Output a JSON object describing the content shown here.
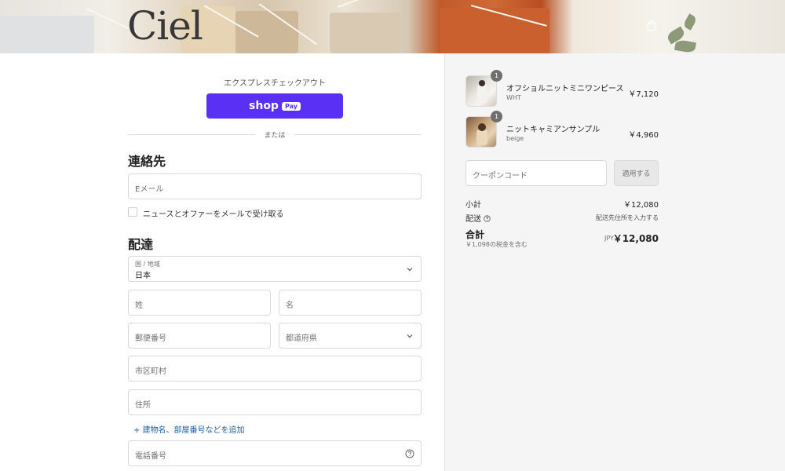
{
  "brand": {
    "logo_text": "Ciel"
  },
  "header": {
    "icon": "shopping-bag-icon"
  },
  "express": {
    "title": "エクスプレスチェックアウト",
    "shop_label": "shop",
    "pay_label": "Pay",
    "accent": "#5a31f4",
    "or_text": "または"
  },
  "contact": {
    "title": "連絡先",
    "email_placeholder": "Eメール",
    "newsletter_label": "ニュースとオファーをメールで受け取る"
  },
  "delivery": {
    "title": "配達",
    "country_label": "国 / 地域",
    "country_value": "日本",
    "last_name_placeholder": "姓",
    "first_name_placeholder": "名",
    "postal_placeholder": "郵便番号",
    "prefecture_placeholder": "都道府県",
    "city_placeholder": "市区町村",
    "address_placeholder": "住所",
    "add_address_link": "+ 建物名、部屋番号などを追加",
    "phone_placeholder": "電話番号"
  },
  "summary": {
    "items": [
      {
        "name": "オフショルニットミニワンピース",
        "variant": "WHT",
        "price": "￥7,120",
        "qty": "1"
      },
      {
        "name": "ニットキャミアンサンプル",
        "variant": "beige",
        "price": "￥4,960",
        "qty": "1"
      }
    ],
    "coupon_placeholder": "クーポンコード",
    "apply_label": "適用する",
    "subtotal_label": "小計",
    "subtotal_value": "￥12,080",
    "shipping_label": "配送",
    "shipping_value": "配送先住所を入力する",
    "total_label": "合計",
    "tax_note": "￥1,098の税金を含む",
    "currency": "JPY",
    "total_value": "￥12,080"
  }
}
